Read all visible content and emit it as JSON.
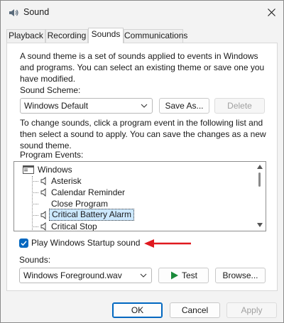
{
  "window": {
    "title": "Sound"
  },
  "tabs": [
    {
      "label": "Playback"
    },
    {
      "label": "Recording"
    },
    {
      "label": "Sounds"
    },
    {
      "label": "Communications"
    }
  ],
  "sounds": {
    "intro": [
      "A sound theme is a set of sounds applied to events in Windows",
      "and programs. You can select an existing theme or save one you",
      "have modified."
    ],
    "scheme_label": "Sound Scheme:",
    "scheme_value": "Windows Default",
    "save_as": "Save As...",
    "delete": "Delete",
    "instructions": [
      "To change sounds, click a program event in the following list and",
      "then select a sound to apply. You can save the changes as a new",
      "sound theme."
    ],
    "events_label": "Program Events:",
    "events": {
      "root": "Windows",
      "items": [
        {
          "label": "Asterisk",
          "icon": "speaker-icon"
        },
        {
          "label": "Calendar Reminder",
          "icon": "speaker-icon"
        },
        {
          "label": "Close Program",
          "icon": ""
        },
        {
          "label": "Critical Battery Alarm",
          "icon": "speaker-icon",
          "selected": true
        },
        {
          "label": "Critical Stop",
          "icon": "speaker-icon"
        }
      ]
    },
    "startup_label": "Play Windows Startup sound",
    "startup_checked": true,
    "sounds_label": "Sounds:",
    "sound_value": "Windows Foreground.wav",
    "test": "Test",
    "browse": "Browse..."
  },
  "footer": {
    "ok": "OK",
    "cancel": "Cancel",
    "apply": "Apply"
  },
  "colors": {
    "accent": "#0067c0",
    "arrow": "#e0191f",
    "test_icon": "#1a8a3a"
  }
}
